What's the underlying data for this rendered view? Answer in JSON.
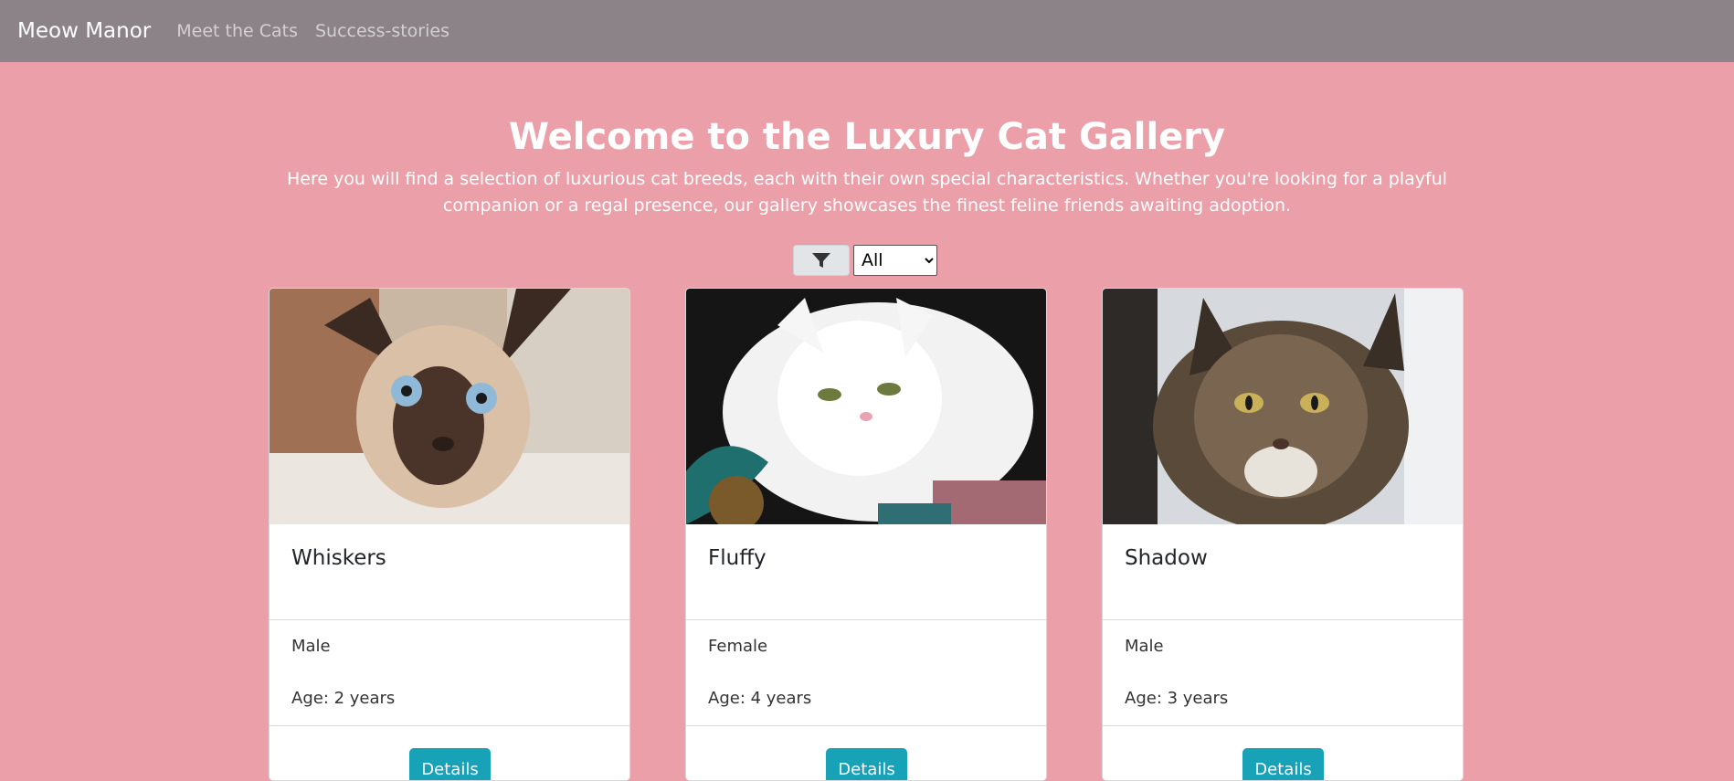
{
  "nav": {
    "brand": "Meow Manor",
    "links": [
      "Meet the Cats",
      "Success-stories"
    ]
  },
  "hero": {
    "title": "Welcome to the Luxury Cat Gallery",
    "description": "Here you will find a selection of luxurious cat breeds, each with their own special characteristics. Whether you're looking for a playful companion or a regal presence, our gallery showcases the finest feline friends awaiting adoption."
  },
  "filter": {
    "icon": "filter-icon",
    "selected": "All"
  },
  "cats": [
    {
      "name": "Whiskers",
      "gender": "Male",
      "age": "Age: 2 years",
      "button": "Details",
      "image": "siamese-cat-photo"
    },
    {
      "name": "Fluffy",
      "gender": "Female",
      "age": "Age: 4 years",
      "button": "Details",
      "image": "white-persian-cat-photo"
    },
    {
      "name": "Shadow",
      "gender": "Male",
      "age": "Age: 3 years",
      "button": "Details",
      "image": "maine-coon-cat-photo"
    }
  ],
  "colors": {
    "background": "#eba0a9",
    "navbar": "#8b8387",
    "button": "#17a2b8"
  }
}
